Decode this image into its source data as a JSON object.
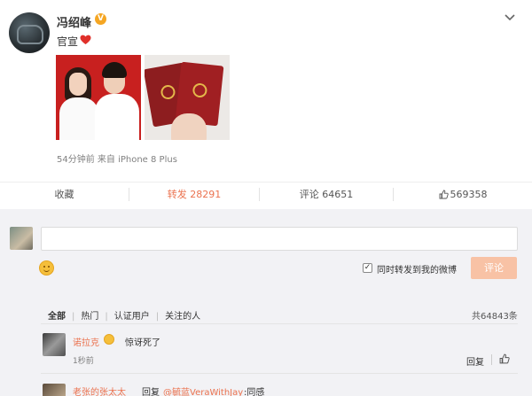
{
  "post": {
    "author": "冯绍峰",
    "verified_badge": "V",
    "expand_icon": "chevron-down-icon",
    "text": "官宣",
    "text_icon": "heart-icon",
    "meta": "54分钟前 来自 iPhone 8 Plus"
  },
  "actions": {
    "favorite": "收藏",
    "repost": "转发 28291",
    "comment": "评论 64651",
    "like": "569358"
  },
  "composer": {
    "checkbox_mark": "✓",
    "repost_label": "同时转发到我的微博",
    "submit_label": "评论"
  },
  "filters": {
    "tabs": [
      "全部",
      "热门",
      "认证用户",
      "关注的人"
    ],
    "total": "共64843条"
  },
  "comments": [
    {
      "user": "诺拉克",
      "text": "惊讶死了",
      "time": "1秒前",
      "reply_label": "回复"
    },
    {
      "user": "老张的张太太",
      "reply_prefix": "回复",
      "mention": "@毓蓝VeraWithJay",
      "tail": ":同感"
    }
  ],
  "colors": {
    "accent": "#eb7350",
    "submit_disabled": "#f8c2a5",
    "verified": "#f5a623",
    "background": "#f2f2f5"
  }
}
